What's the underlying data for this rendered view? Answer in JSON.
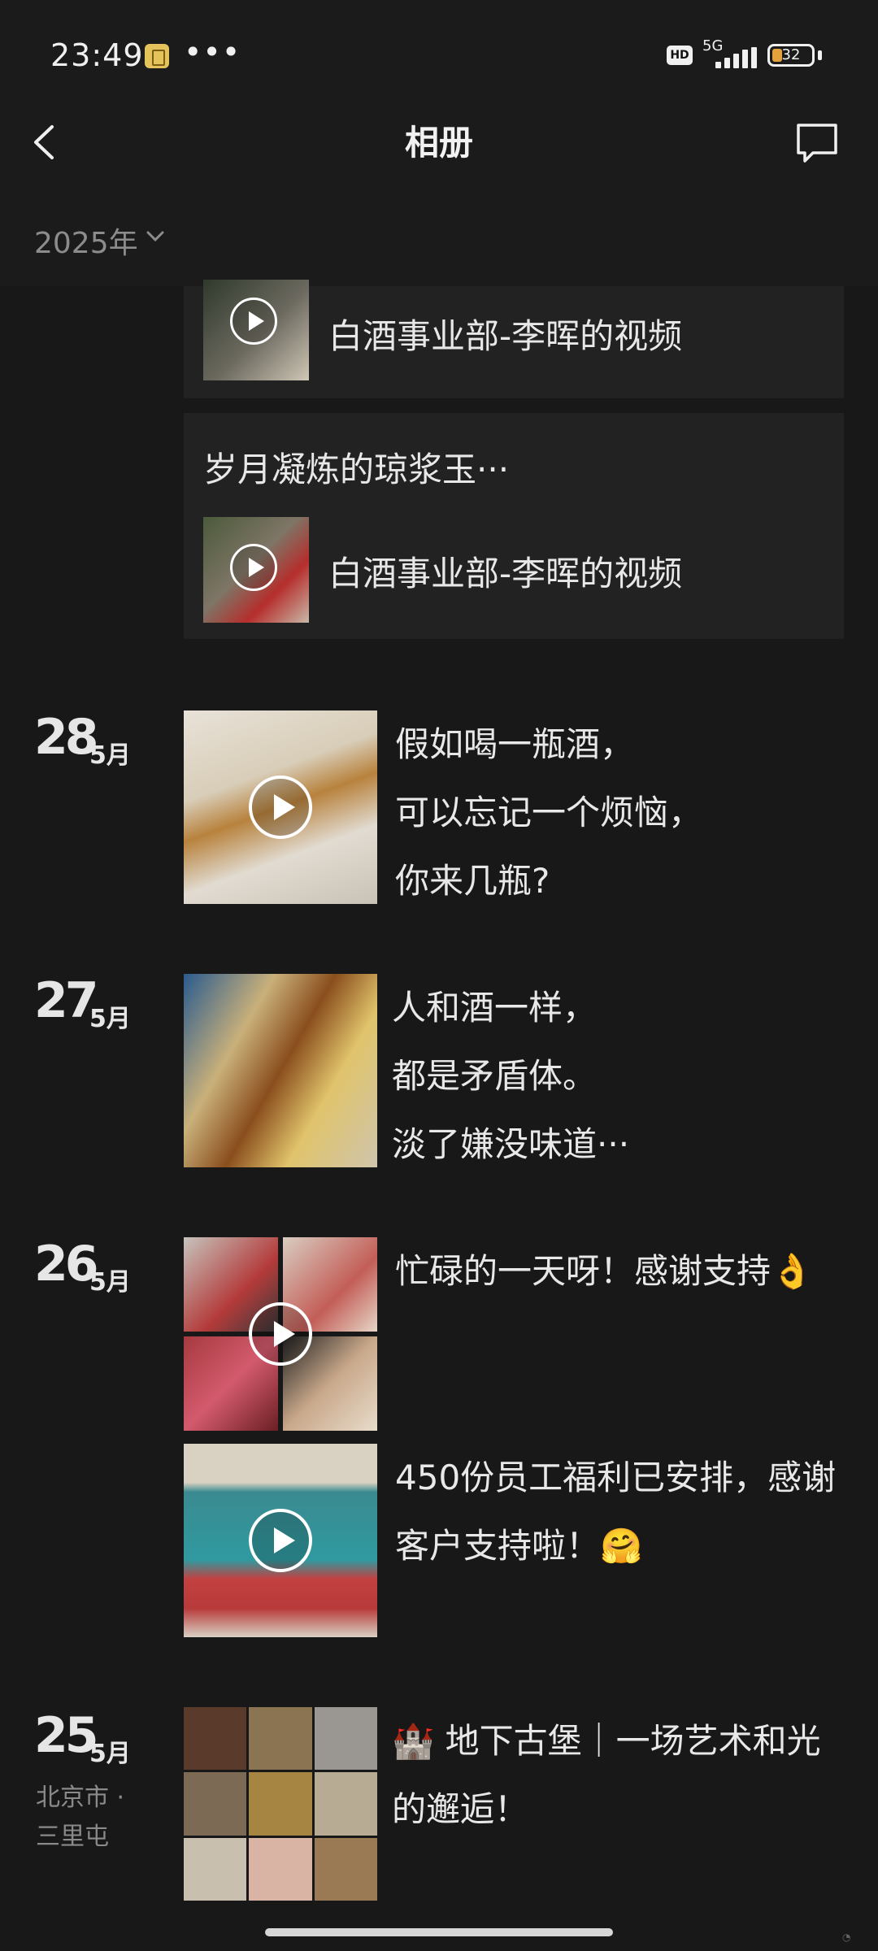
{
  "status_bar": {
    "time": "23:49",
    "dots": "•••",
    "hd": "HD",
    "network": "5G",
    "battery": "32"
  },
  "header": {
    "title": "相册",
    "year_filter": "2025年"
  },
  "partial_posts": [
    {
      "video_title": "白酒事业部-李晖的视频"
    },
    {
      "caption": "岁月凝炼的琼浆玉···",
      "video_title": "白酒事业部-李晖的视频"
    }
  ],
  "posts": [
    {
      "day": "28",
      "month": "5月",
      "lines": [
        "假如喝一瓶酒，",
        "可以忘记一个烦恼，",
        "你来几瓶?"
      ]
    },
    {
      "day": "27",
      "month": "5月",
      "lines": [
        "人和酒一样，",
        "都是矛盾体。",
        "淡了嫌没味道···"
      ]
    },
    {
      "day": "26",
      "month": "5月",
      "entries": [
        {
          "text": "忙碌的一天呀！感谢支持👌"
        },
        {
          "text": "450份员工福利已安排，感谢客户支持啦！🤗"
        }
      ]
    },
    {
      "day": "25",
      "month": "5月",
      "location_city": "北京市 ·",
      "location_place": "三里屯",
      "text": "🏰 地下古堡｜一场艺术和光的邂逅！"
    }
  ]
}
